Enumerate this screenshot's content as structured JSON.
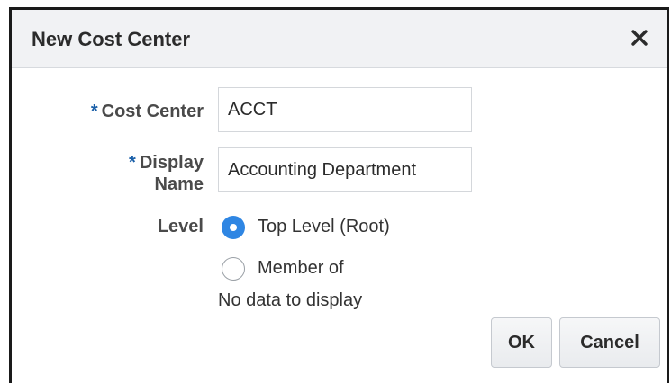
{
  "dialog": {
    "title": "New Cost Center",
    "close_icon": "close-icon"
  },
  "form": {
    "required_marker": "*",
    "cost_center": {
      "label": "Cost Center",
      "value": "ACCT",
      "required": true
    },
    "display_name": {
      "label_line1": "Display",
      "label_line2": "Name",
      "value": "Accounting Department",
      "required": true
    },
    "level": {
      "label": "Level",
      "options": [
        {
          "label": "Top Level (Root)",
          "selected": true
        },
        {
          "label": "Member of",
          "selected": false
        }
      ],
      "empty_text": "No data to display"
    }
  },
  "buttons": {
    "ok_label": "OK",
    "cancel_label": "Cancel"
  },
  "colors": {
    "accent": "#2f86e3",
    "required": "#1a5fa8",
    "titlebar_bg": "#f1f2f4"
  }
}
